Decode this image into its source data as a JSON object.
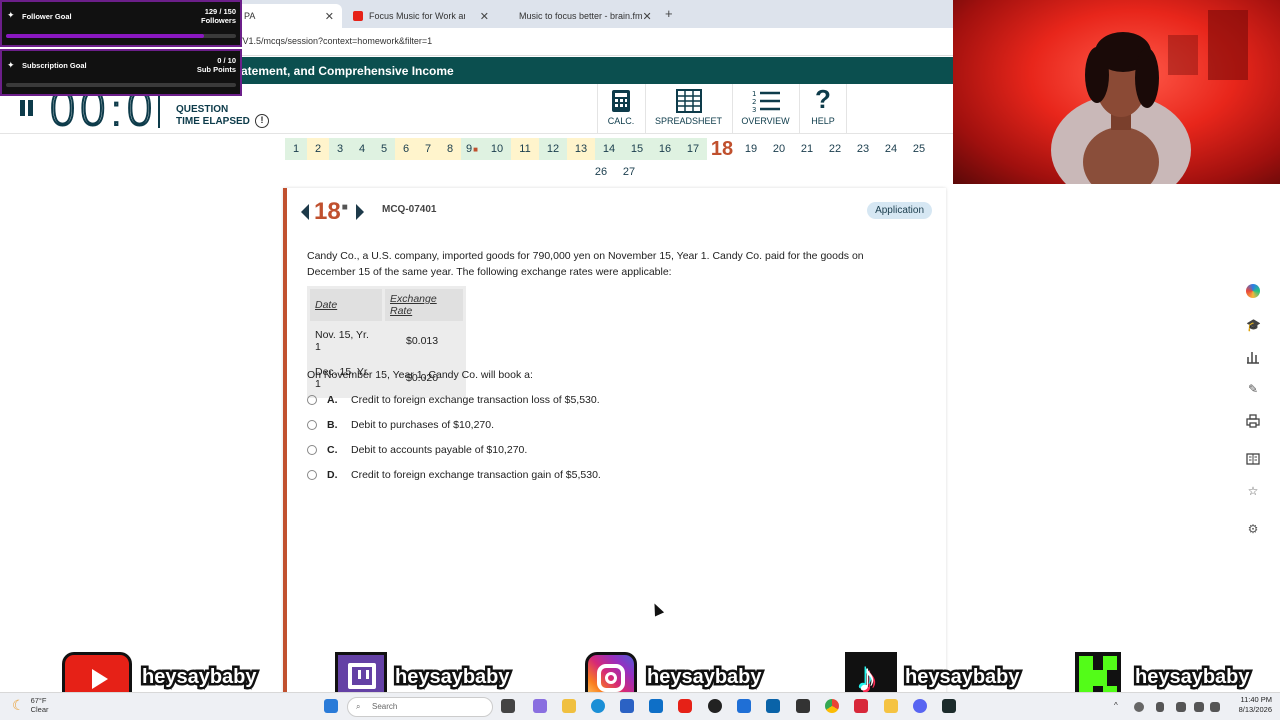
{
  "browser": {
    "tabs": [
      {
        "label": "PA"
      },
      {
        "label": "Focus Music for Work and S"
      },
      {
        "label": "Music to focus better - brain.fm"
      }
    ],
    "url": "/V1.5/mcqs/session?context=homework&filter=1"
  },
  "app": {
    "title": "atement, and Comprehensive Income",
    "timer": "00:0",
    "time_label_1": "QUESTION",
    "time_label_2": "TIME ELAPSED",
    "info": "!",
    "tools": [
      {
        "label": "CALC.",
        "icon": "calculator-icon"
      },
      {
        "label": "SPREADSHEET",
        "icon": "spreadsheet-icon"
      },
      {
        "label": "OVERVIEW",
        "icon": "overview-list-icon"
      },
      {
        "label": "HELP",
        "icon": "help-icon"
      }
    ]
  },
  "question_numbers": {
    "row1": [
      {
        "n": "1",
        "status": "answered"
      },
      {
        "n": "2",
        "status": "flagged"
      },
      {
        "n": "3",
        "status": "answered"
      },
      {
        "n": "4",
        "status": "answered"
      },
      {
        "n": "5",
        "status": "answered"
      },
      {
        "n": "6",
        "status": "flagged"
      },
      {
        "n": "7",
        "status": "flagged"
      },
      {
        "n": "8",
        "status": "flagged"
      },
      {
        "n": "9",
        "status": "answered",
        "bookmark": true
      },
      {
        "n": "10",
        "status": "answered"
      },
      {
        "n": "11",
        "status": "flagged"
      },
      {
        "n": "12",
        "status": "answered"
      },
      {
        "n": "13",
        "status": "flagged"
      },
      {
        "n": "14",
        "status": "answered"
      },
      {
        "n": "15",
        "status": "answered"
      },
      {
        "n": "16",
        "status": "answered"
      },
      {
        "n": "17",
        "status": "answered"
      },
      {
        "n": "18",
        "status": "current"
      },
      {
        "n": "19",
        "status": "unanswered"
      },
      {
        "n": "20",
        "status": "unanswered"
      },
      {
        "n": "21",
        "status": "unanswered"
      },
      {
        "n": "22",
        "status": "unanswered"
      },
      {
        "n": "23",
        "status": "unanswered"
      },
      {
        "n": "24",
        "status": "unanswered"
      },
      {
        "n": "25",
        "status": "unanswered"
      }
    ],
    "row2": [
      {
        "n": "26",
        "status": "unanswered"
      },
      {
        "n": "27",
        "status": "unanswered"
      }
    ]
  },
  "question": {
    "number": "18",
    "id": "MCQ-07401",
    "category": "Application",
    "stem": "Candy Co., a U.S. company, imported goods for 790,000 yen on November 15, Year 1. Candy Co. paid for the goods on December 15 of the same year. The following exchange rates were applicable:",
    "table": {
      "headers": [
        "Date",
        "Exchange Rate"
      ],
      "rows": [
        [
          "Nov. 15, Yr. 1",
          "$0.013"
        ],
        [
          "Dec. 15, Yr. 1",
          "$0.020"
        ]
      ]
    },
    "prompt": "On November 15, Year 1, Candy Co. will book a:",
    "choices": [
      {
        "letter": "A.",
        "text": "Credit to foreign exchange transaction loss of $5,530."
      },
      {
        "letter": "B.",
        "text": "Debit to purchases of $10,270."
      },
      {
        "letter": "C.",
        "text": "Debit to accounts payable of $10,270."
      },
      {
        "letter": "D.",
        "text": "Credit to foreign exchange transaction gain of $5,530."
      }
    ]
  },
  "sidebar_icons": [
    "copilot-icon",
    "graduation-cap-icon",
    "bar-chart-icon",
    "edit-icon",
    "print-icon",
    "reader-icon",
    "star-icon",
    "settings-icon"
  ],
  "overlay": {
    "follower_goal": {
      "title": "Follower Goal",
      "count": "129 / 150",
      "unit": "Followers",
      "progress": 0.86
    },
    "subscription_goal": {
      "title": "Subscription Goal",
      "count": "0 / 10",
      "unit": "Sub Points",
      "progress": 0.0
    }
  },
  "socials": [
    {
      "platform": "youtube-icon",
      "handle": "heysaybaby",
      "color": "#e62117"
    },
    {
      "platform": "twitch-icon",
      "handle": "heysaybaby",
      "color": "#6441a5"
    },
    {
      "platform": "instagram-icon",
      "handle": "heysaybaby",
      "color": "#d62976"
    },
    {
      "platform": "tiktok-icon",
      "handle": "heysaybaby",
      "color": "#111111"
    },
    {
      "platform": "kick-icon",
      "handle": "heysaybaby",
      "color": "#53fc18"
    }
  ],
  "taskbar": {
    "weather_temp": "67°F",
    "weather_desc": "Clear",
    "search_placeholder": "Search",
    "time": "11:40 PM",
    "date": "8/13/2026"
  },
  "colors": {
    "accent": "#c0502e",
    "header": "#0b4f4f",
    "answered": "#dff2e1",
    "flagged": "#fff4cc"
  }
}
